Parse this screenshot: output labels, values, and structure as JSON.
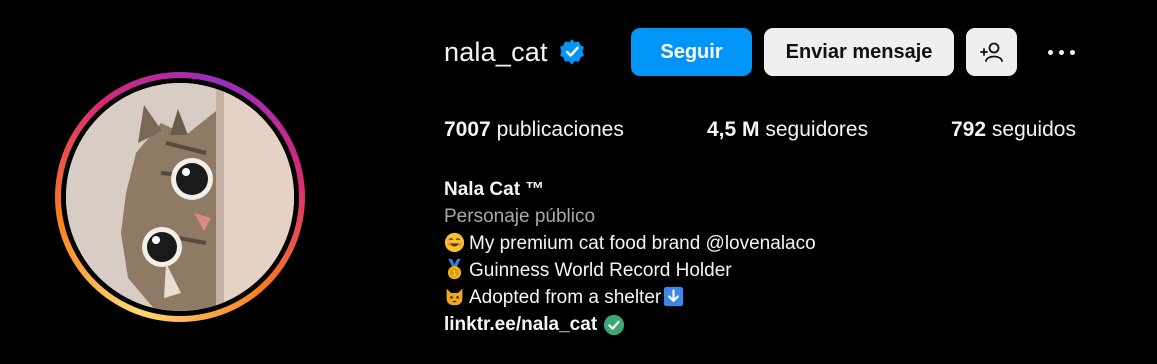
{
  "profile": {
    "username": "nala_cat",
    "follow_label": "Seguir",
    "message_label": "Enviar mensaje",
    "suggest_icon": "person-add-icon",
    "more_icon": "more-horizontal-icon",
    "verified_icon": "verified-badge-icon"
  },
  "stats": {
    "posts_count": "7007",
    "posts_label": "publicaciones",
    "followers_count": "4,5 M",
    "followers_label": "seguidores",
    "following_count": "792",
    "following_label": "seguidos"
  },
  "bio": {
    "name": "Nala Cat ™",
    "category": "Personaje público",
    "line1": "My premium cat food brand @lovenalaco",
    "line1_icon": "smiling-face-emoji",
    "line2": "Guinness World Record Holder",
    "line2_icon": "medal-emoji",
    "line3": "Adopted from a shelter",
    "line3_icon": "cat-face-emoji",
    "line3_trailing_icon": "down-arrow-emoji",
    "link": "linktr.ee/nala_cat",
    "link_icon": "check-circle-icon"
  },
  "colors": {
    "accent": "#0095f6",
    "secondary_button": "#efefef",
    "muted_text": "#a8a8a8",
    "background": "#000000"
  }
}
